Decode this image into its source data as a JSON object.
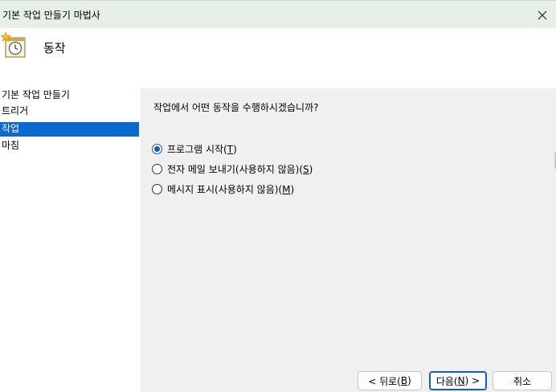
{
  "window": {
    "title": "기본 작업 만들기 마법사"
  },
  "titlebar": {
    "close_glyph": "✕"
  },
  "header": {
    "title": "동작",
    "icon": "clock-wizard-icon"
  },
  "sidebar": {
    "items": [
      {
        "label": "기본 작업 만들기",
        "active": false
      },
      {
        "label": "트리거",
        "active": false
      },
      {
        "label": "작업",
        "active": true
      },
      {
        "label": "마침",
        "active": false
      }
    ]
  },
  "content": {
    "question": "작업에서 어떤 동작을 수행하시겠습니까?",
    "options": [
      {
        "text": "프로그램 시작(",
        "accel": "T",
        "close": ")",
        "checked": true
      },
      {
        "text": "전자 메일 보내기(사용하지 않음)(",
        "accel": "S",
        "close": ")",
        "checked": false
      },
      {
        "text": "메시지 표시(사용하지 않음)(",
        "accel": "M",
        "close": ")",
        "checked": false
      }
    ]
  },
  "buttons": {
    "back": {
      "pre": "< 뒤로(",
      "accel": "B",
      "post": ")"
    },
    "next": {
      "pre": "다음(",
      "accel": "N",
      "post": ") >"
    },
    "cancel": {
      "label": "취소"
    }
  },
  "colors": {
    "accent": "#0a6ad1",
    "titlebar": "#e6f0e6"
  }
}
